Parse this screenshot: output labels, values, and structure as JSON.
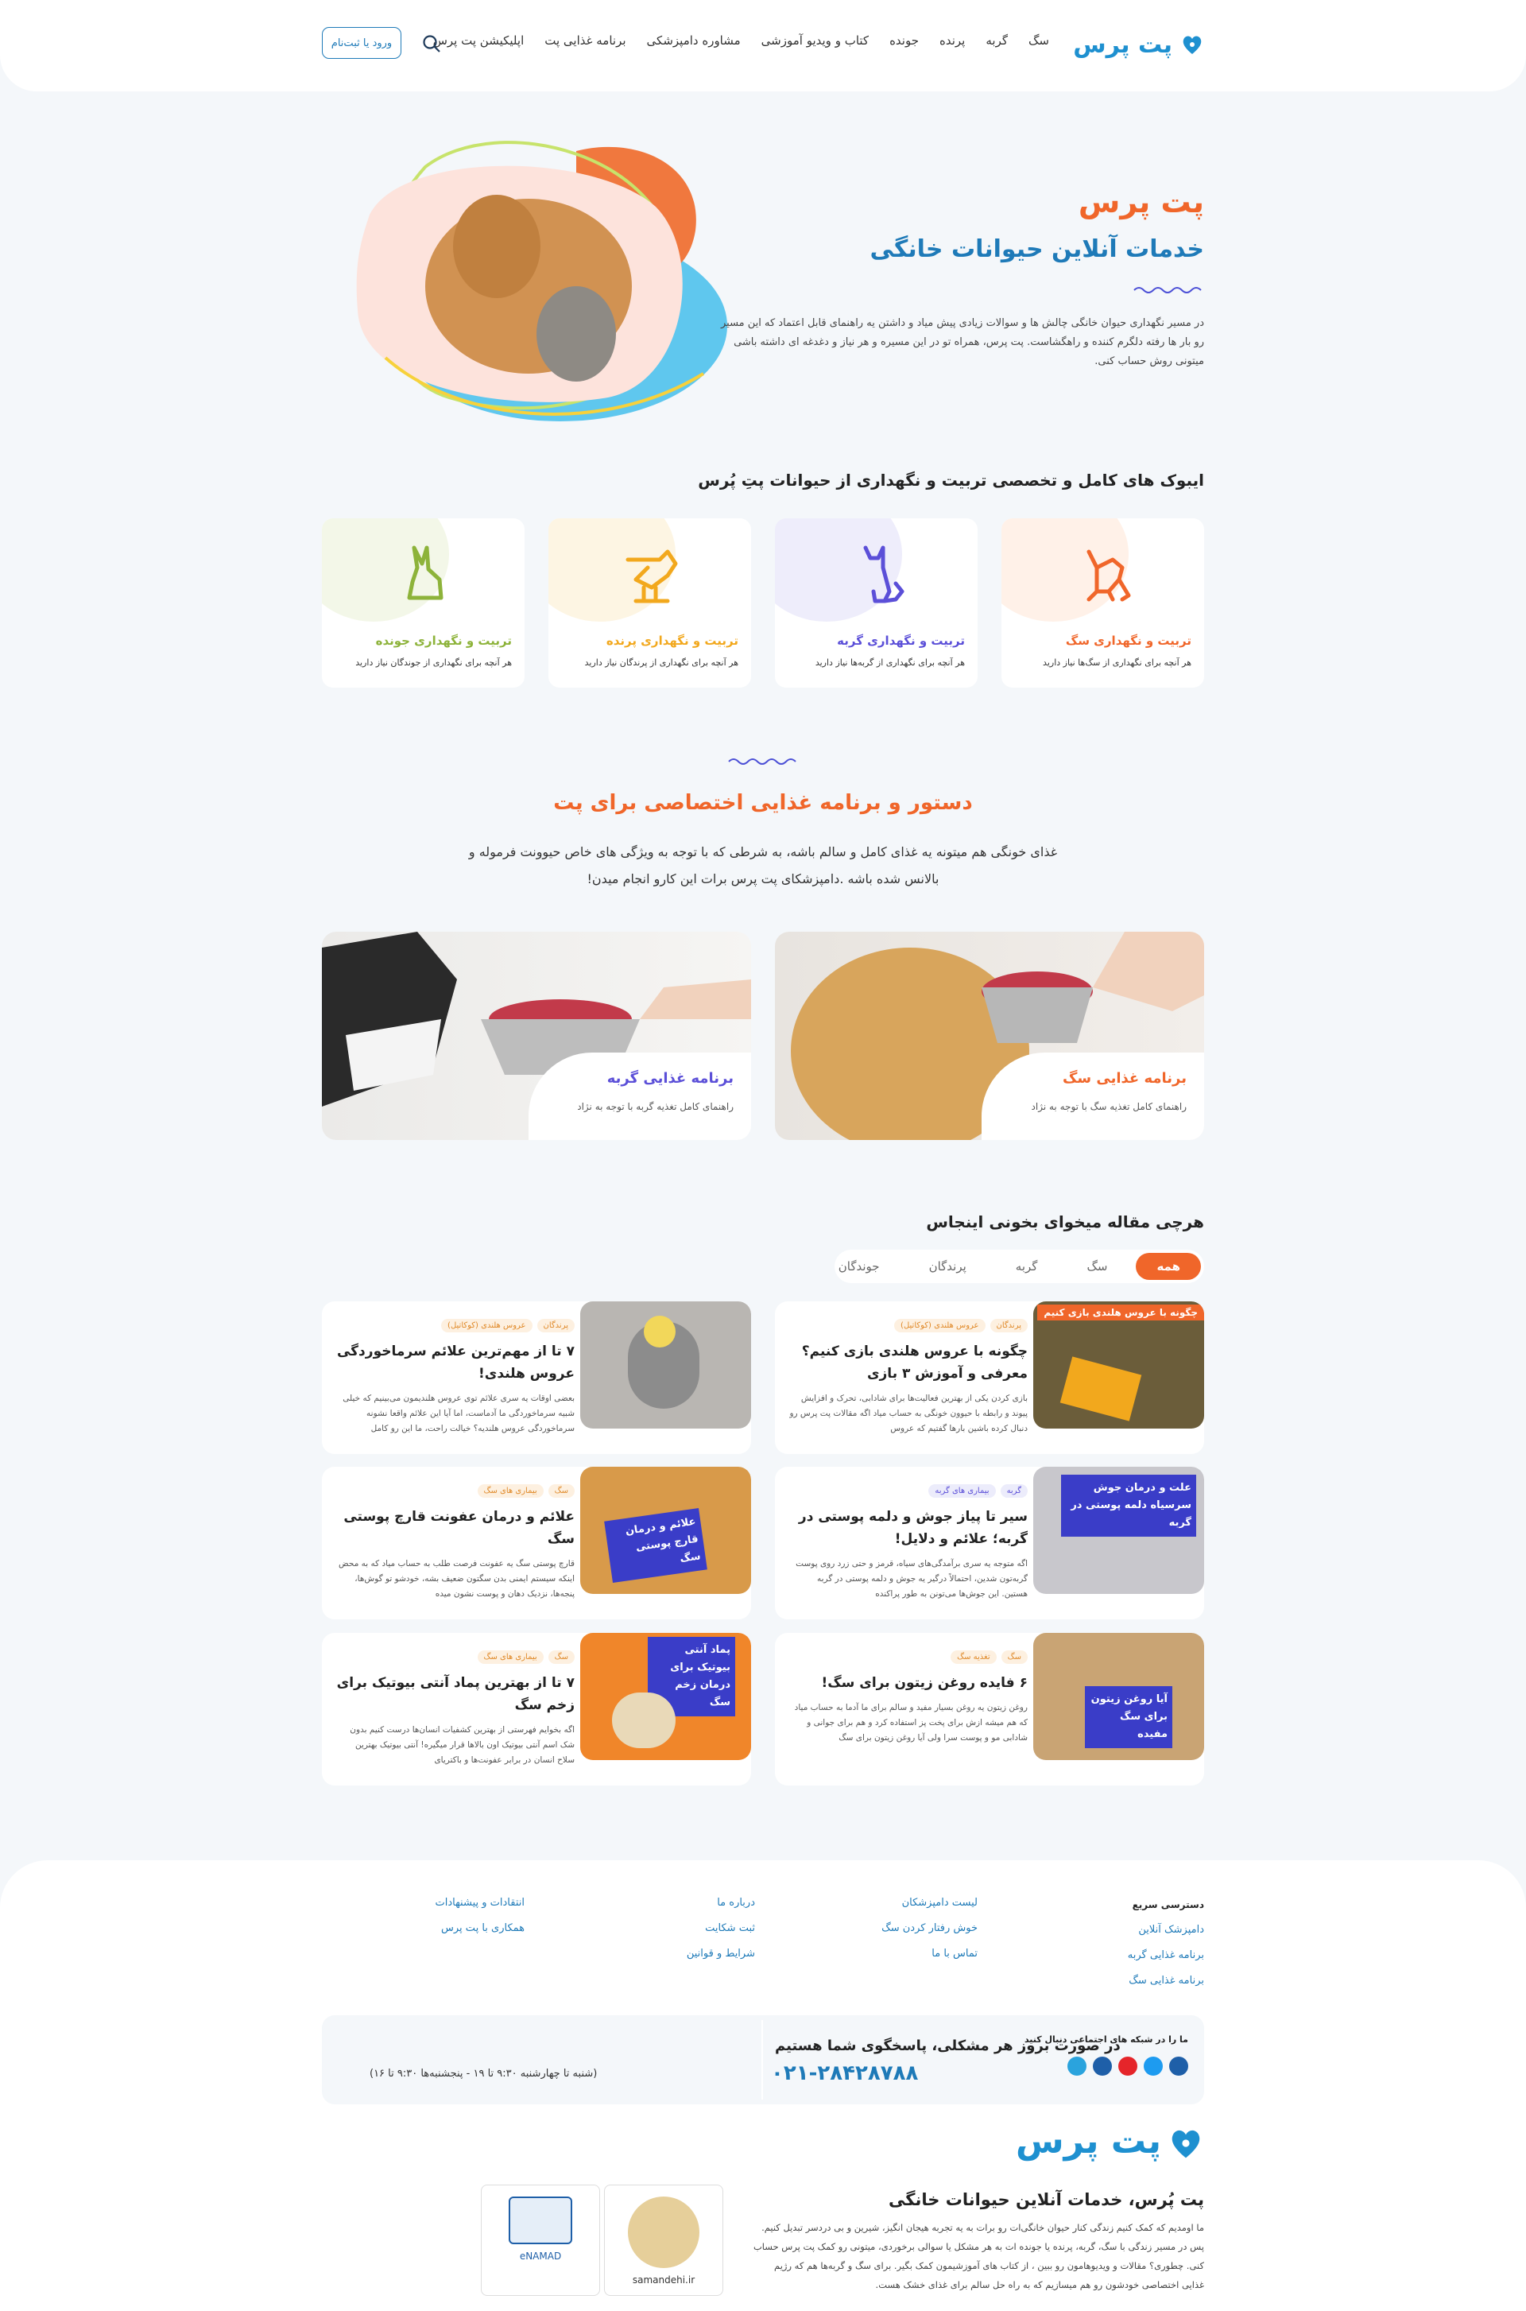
{
  "header": {
    "logo": "پت پرس",
    "nav": [
      "سگ",
      "گربه",
      "پرنده",
      "جونده",
      "کتاب و ویدیو آموزشی",
      "مشاوره دامپزشکی",
      "برنامه غذایی پت",
      "اپلیکیشن پت پرس"
    ],
    "login": "ورود یا ثبت‌نام"
  },
  "hero": {
    "title": "پت پرس",
    "subtitle": "خدمات آنلاین حیوانات خانگی",
    "desc": "در مسیر نگهداری حیوان خانگی چالش ها و سوالات زیادی پیش میاد و داشتن یه راهنمای قابل اعتماد که این مسیر رو بار ها رفته دلگرم کننده و راهگشاست. پت پرس، همراه تو در این مسیره و هر نیاز و دغدغه ای داشته باشی میتونی روش حساب کنی."
  },
  "ebooks": {
    "title": "ایبوک های کامل و تخصصی تربیت و نگهداری از حیوانات پتِ پُرس",
    "cards": [
      {
        "title": "تربیت و نگهداری سگ",
        "desc": "هر آنچه برای نگهداری از سگ‌ها نیاز دارید",
        "color": "#f0662a",
        "icon": "dog-icon"
      },
      {
        "title": "تربیت و نگهداری گربه",
        "desc": "هر آنچه برای نگهداری از گربه‌ها نیاز دارید",
        "color": "#5b4fd8",
        "icon": "cat-icon"
      },
      {
        "title": "تربیت و نگهداری پرنده",
        "desc": "هر آنچه برای نگهداری از پرندگان نیاز دارید",
        "color": "#f2a81d",
        "icon": "bird-icon"
      },
      {
        "title": "تربیت و نگهداری جونده",
        "desc": "هر آنچه برای نگهداری از جوندگان نیاز دارید",
        "color": "#8db33a",
        "icon": "rabbit-icon"
      }
    ]
  },
  "diet": {
    "title": "دستور و برنامه غذایی اختصاصی برای پت",
    "desc": "غذای خونگی هم میتونه یه غذای کامل و سالم باشه، به شرطی که با توجه به ویژگی های خاص حیوونت فرموله و بالانس شده باشه .دامپزشکای پت پرس برات این کارو انجام میدن!",
    "dog": {
      "title": "برنامه غذایی سگ",
      "desc": "راهنمای کامل تغذیه سگ با توجه به نژاد"
    },
    "cat": {
      "title": "برنامه غذایی گربه",
      "desc": "راهنمای کامل تغذیه گربه با توجه به نژاد"
    }
  },
  "articles": {
    "title": "هرچی مقاله میخوای بخونی اینجاس",
    "tabs": [
      "همه",
      "سگ",
      "گربه",
      "پرندگان",
      "جوندگان"
    ],
    "items": [
      {
        "tags": [
          "پرندگان",
          "عروس هلندی (کوکاتیل)"
        ],
        "title": "چگونه با عروس هلندی بازی کنیم؟ معرفی و آموزش ۳ بازی",
        "desc": "بازی کردن یکی از بهترین فعالیت‌ها برای شادابی، تحرک و افزایش پیوند و رابطه با حیوون خونگی به حساب میاد اگه مقالات پت پرس رو دنبال کرده باشین بارها گفتیم که عروس",
        "img": "چگونه با عروس هلندی بازی کنیم"
      },
      {
        "tags": [
          "پرندگان",
          "عروس هلندی (کوکاتیل)"
        ],
        "title": "۷ تا از مهم‌ترین علائم سرماخوردگی عروس هلندی!",
        "desc": "بعضی اوقات یه سری علائم توی عروس هلندیمون می‌بینیم که خیلی شبیه سرماخوردگی ما آدماست، اما آیا این علائم واقعا نشونه سرماخوردگی عروس هلندیه؟ خیالت راحت، ما این رو کامل",
        "img": ""
      },
      {
        "tags": [
          "گربه",
          "بیماری های گربه"
        ],
        "title": "سیر تا پیاز جوش و دلمه پوستی در گربه؛ علائم و دلایل!",
        "desc": "اگه متوجه یه سری برآمدگی‌های سیاه، قرمز و حتی زرد روی پوست گربه‌تون شدین، احتمالاً درگیر یه جوش و دلمه پوستی در گربه هستین. این جوش‌ها می‌تونن به طور پراکنده",
        "img": "علت و درمان جوش سرسیاه دلمه پوستی در گربه"
      },
      {
        "tags": [
          "سگ",
          "بیماری های سگ"
        ],
        "title": "علائم و درمان عفونت قارچ پوستی سگ",
        "desc": "قارچ پوستی سگ یه عفونت فرصت طلب به حساب میاد که به محض اینکه سیستم ایمنی بدن سگتون ضعیف بشه، خودشو تو گوش‌ها، پنجه‌ها، نزدیک دهان و پوست نشون میده",
        "img": "علائم و درمان قارچ پوستی سگ"
      },
      {
        "tags": [
          "سگ",
          "تغذیه سگ"
        ],
        "title": "۶ فایده روغن زیتون برای سگ!",
        "desc": "روغن زیتون یه روغن بسیار مفید و سالم برای ما آدما به حساب میاد که هم میشه ازش برای پخت پز استفاده کرد و هم برای جوانی و شادابی مو و پوست سرا ولی آیا روغن زیتون برای سگ",
        "img": "آیا روغن زیتون برای سگ مفیده"
      },
      {
        "tags": [
          "سگ",
          "بیماری های سگ"
        ],
        "title": "۷ تا از بهترین پماد آنتی بیوتیک برای زخم سگ",
        "desc": "اگه بخوایم فهرستی از بهترین کشفیات انسان‌ها درست کنیم بدون شک اسم آنتی بیوتیک اون بالاها قرار میگیره! آنتی بیوتیک بهترین سلاح انسان در برابر عفونت‌ها و باکتریای",
        "img": "پماد آنتی بیوتیک برای درمان زخم سگ"
      }
    ]
  },
  "footer": {
    "quick_title": "دسترسی سریع",
    "quick": [
      "دامپزشک آنلاین",
      "برنامه غذایی گربه",
      "برنامه غذایی سگ"
    ],
    "col2": [
      "لیست دامپزشکان",
      "خوش رفتار کردن سگ",
      "تماس با ما"
    ],
    "col3": [
      "درباره ما",
      "ثبت شکایت",
      "شرایط و قوانین"
    ],
    "col4": [
      "انتقادات و پیشنهادات",
      "همکاری با پت پرس"
    ],
    "social_title": "ما را در شبکه های اجتماعی دنبال کنید",
    "contact_title": "در صورت بروز هر مشکلی، پاسخگوی شما هستیم",
    "phone": "۰۲۱-۲۸۴۲۸۷۸۸",
    "hours": "(شنبه تا چهارشنبه ۹:۳۰ تا ۱۹ - پنجشنبه‌ها ۹:۳۰ تا ۱۶)",
    "logo": "پت پرس",
    "title": "پت پُرس، خدمات آنلاین حیوانات خانگی",
    "desc": "ما اومدیم که کمک کنیم زندگی کنار حیوان خانگی‌ات رو برات به یه تجربه هیجان انگیز، شیرین و بی دردسر تبدیل کنیم. پس در مسیر زندگی با سگ، گربه، پرنده یا جونده ات به هر مشکل یا سوالی برخوردی، میتونی رو کمک پت پرس حساب کنی. چطوری؟ مقالات و ویدیوهامون رو ببین ، از کتاب های آموزشیمون کمک بگیر. برای سگ و گربه‌ها هم که رژیم غذایی اختصاصی خودشون رو هم میسازیم که به راه حل سالم برای غذای خشک هست.",
    "badge1": "samandehi.ir",
    "badge2": "eNAMAD"
  }
}
